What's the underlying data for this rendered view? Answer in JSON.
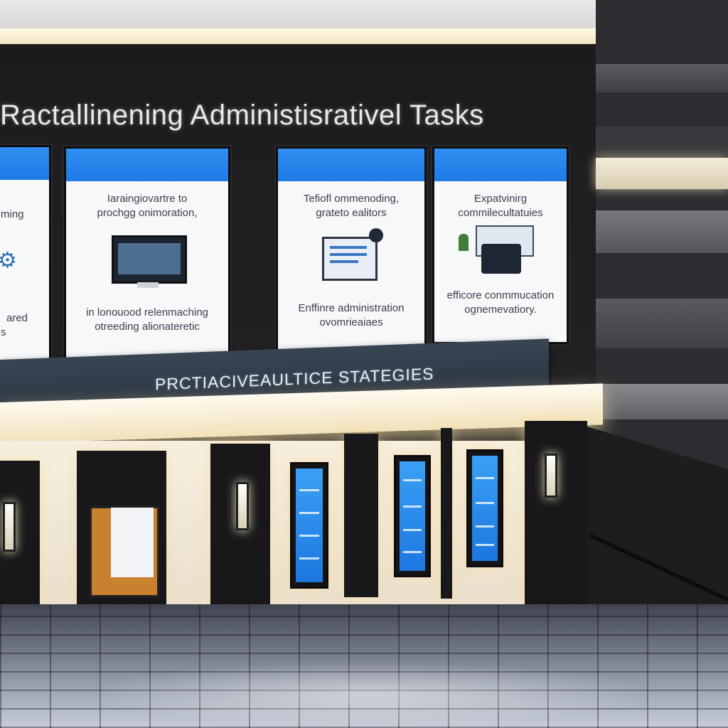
{
  "title": "Ractallinening Administisrativel Tasks",
  "banner": "PRCTIACIVEAULTICE STATEGIES",
  "panels": [
    {
      "lines": [
        "ming",
        "ared",
        "s"
      ]
    },
    {
      "top": [
        "Iaraingiovartre to",
        "prochgg onimoration,"
      ],
      "bottom": [
        "in lonouood relenmaching",
        "otreeding alionateretic"
      ]
    },
    {
      "top": [
        "Tefiofl ommenoding,",
        "grateto ealitors"
      ],
      "bottom": [
        "Enffinre administration",
        "ovomrieaiaes"
      ]
    },
    {
      "top": [
        "Expatvinirg",
        "commilecultatuies"
      ],
      "bottom": [
        "efficore conmmucation",
        "ognemevatiory."
      ]
    }
  ],
  "icons": [
    "gear-icon",
    "monitor-icon",
    "document-icon",
    "briefcase-icon"
  ]
}
